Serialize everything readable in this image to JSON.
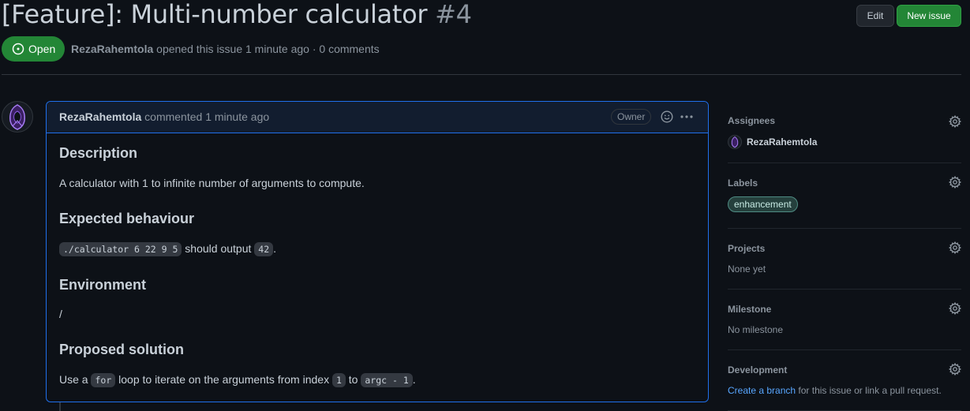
{
  "issue": {
    "title": "[Feature]: Multi-number calculator",
    "number": "#4",
    "state": "Open",
    "author": "RezaRahemtola",
    "meta_text": "opened this issue 1 minute ago · 0 comments"
  },
  "header_buttons": {
    "edit": "Edit",
    "new_issue": "New issue"
  },
  "comment": {
    "author": "RezaRahemtola",
    "time": "commented 1 minute ago",
    "badge": "Owner",
    "h_description": "Description",
    "description": "A calculator with 1 to infinite number of arguments to compute.",
    "h_expected": "Expected behaviour",
    "expected_code": "./calculator 6 22 9 5",
    "expected_mid": "should output",
    "expected_result": "42",
    "period": ".",
    "h_environment": "Environment",
    "environment": "/",
    "h_solution": "Proposed solution",
    "sol_1": "Use a",
    "sol_code1": "for",
    "sol_2": "loop to iterate on the arguments from index",
    "sol_code2": "1",
    "sol_3": "to",
    "sol_code3": "argc - 1",
    "sol_end": "."
  },
  "sidebar": {
    "assignees_h": "Assignees",
    "assignee": "RezaRahemtola",
    "labels_h": "Labels",
    "label": "enhancement",
    "projects_h": "Projects",
    "projects_v": "None yet",
    "milestone_h": "Milestone",
    "milestone_v": "No milestone",
    "development_h": "Development",
    "dev_link": "Create a branch",
    "dev_rest": "for this issue or link a pull request."
  },
  "colors": {
    "accent": "#1f6feb",
    "open_green": "#238636",
    "link": "#58a6ff",
    "bg": "#0d1117"
  }
}
